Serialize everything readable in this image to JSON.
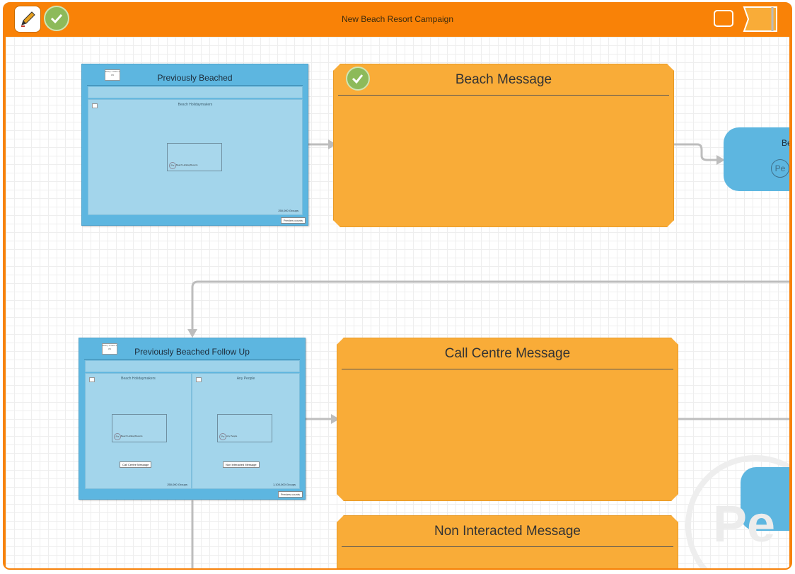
{
  "window": {
    "title": "New Beach Resort Campaign"
  },
  "toolbar": {
    "edit_icon": "pencil-icon",
    "approve_icon": "check-icon"
  },
  "colors": {
    "frame": "#f98207",
    "decision_box": "#5db6e0",
    "message_box": "#f9ac38",
    "check": "#8dba5a"
  },
  "nodes": {
    "previously_beached": {
      "title": "Previously Beached",
      "badge": "Every 1 View 1 3%",
      "panel_title": "Beach Holidaymakers",
      "doc_label": "Beach Holiday/Resorts",
      "count": "250,000 Groups",
      "preview": "Preview counts"
    },
    "beach_message": {
      "title": "Beach Message"
    },
    "follow_up": {
      "title": "Previously Beached Follow Up",
      "badge": "Every 1 View 1 3%",
      "panel1": {
        "title": "Beach Holidaymakers",
        "doc_label": "Beach Holiday/Resorts",
        "select": "Call Centre Message",
        "count": "250,000 Groups"
      },
      "panel2": {
        "title": "Any People",
        "doc_label": "Any People",
        "select": "Non Interacted Message",
        "count": "1,100,000 Groups"
      },
      "preview": "Preview counts"
    },
    "call_centre": {
      "title": "Call Centre Message"
    },
    "non_interacted": {
      "title": "Non Interacted Message"
    },
    "right_node": {
      "title": "Be",
      "icon_text": "Pe"
    },
    "watermark": {
      "text": "Pe"
    }
  }
}
